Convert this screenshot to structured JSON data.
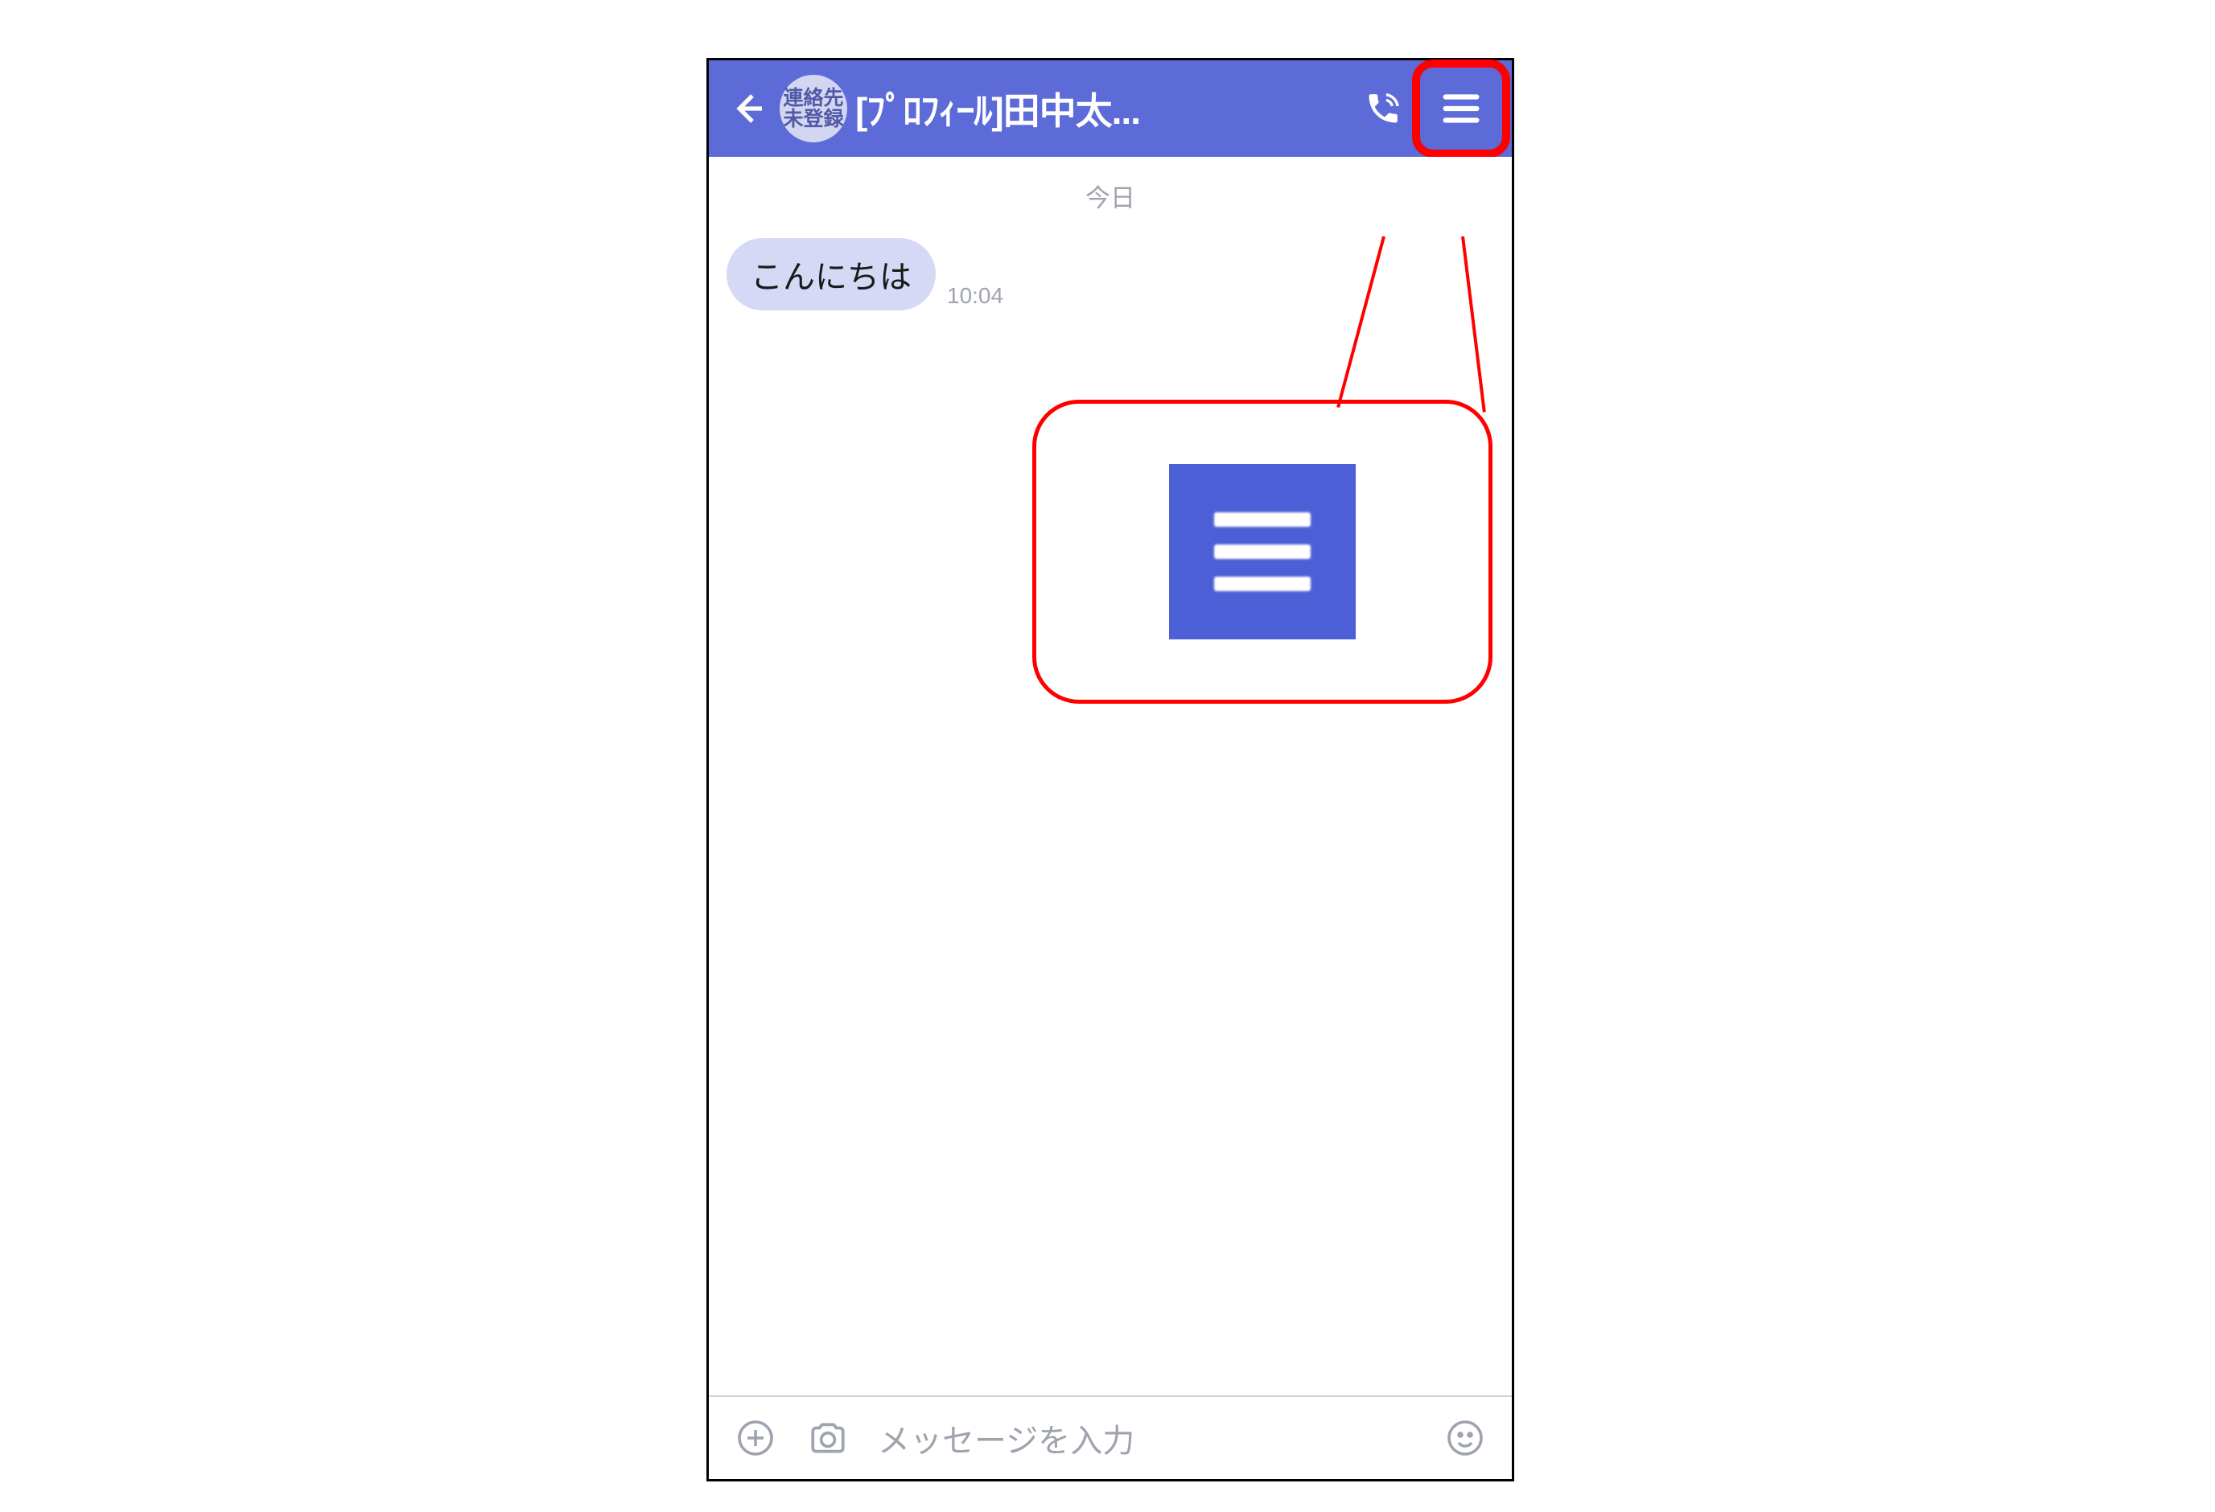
{
  "header": {
    "badge_line1": "連絡先",
    "badge_line2": "未登録",
    "title": "[ﾌﾟﾛﾌｨｰﾙ]田中太..."
  },
  "chat": {
    "date_label": "今日",
    "messages": [
      {
        "text": "こんにちは",
        "time": "10:04"
      }
    ]
  },
  "input": {
    "placeholder": "メッセージを入力"
  },
  "colors": {
    "header_bg": "#5c6bd7",
    "highlight": "#ff0000",
    "bubble_bg": "#d5d9f5"
  }
}
